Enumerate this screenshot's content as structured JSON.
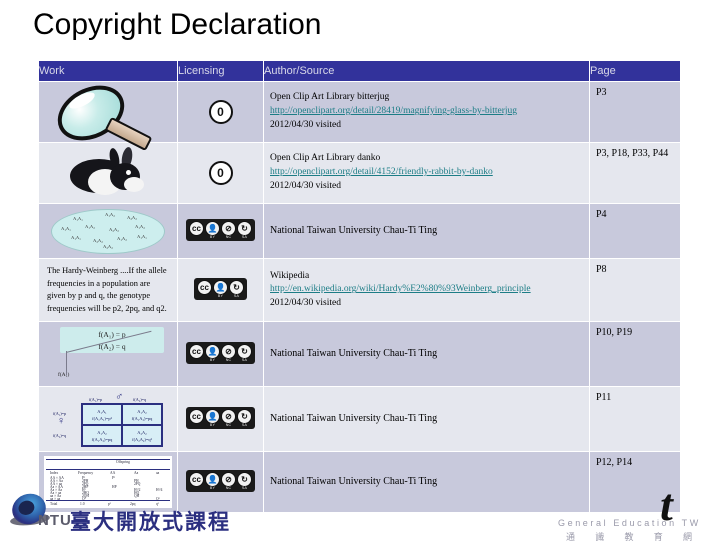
{
  "title": "Copyright Declaration",
  "table": {
    "columns": [
      "Work",
      "Licensing",
      "Author/Source",
      "Page"
    ],
    "rows": [
      {
        "work_kind": "magnifier-thumbnail",
        "license": "cc0",
        "license_label": "0",
        "source_title": "Open Clip Art Library bitterjug",
        "source_url": "http://openclipart.org/detail/28419/magnifying-glass-by-bitterjug",
        "source_date": "2012/04/30 visited",
        "page": "P3"
      },
      {
        "work_kind": "rabbit-thumbnail",
        "license": "cc0",
        "license_label": "0",
        "source_title": "Open Clip Art Library danko",
        "source_url": "http://openclipart.org/detail/4152/friendly-rabbit-by-danko",
        "source_date": "2012/04/30 visited",
        "page": "P3, P18, P33, P44"
      },
      {
        "work_kind": "gene-pool-thumbnail",
        "license": "cc-by-nc-sa",
        "license_marks": [
          "BY",
          "NC",
          "SA"
        ],
        "source_plain": "National Taiwan University Chau-Ti Ting",
        "page": "P4"
      },
      {
        "work_kind": "text-excerpt",
        "work_text": "The Hardy-Weinberg ....If the allele frequencies in a population are given by p and q, the genotype frequencies will be p2, 2pq, and q2.",
        "license": "cc-by-sa",
        "license_marks": [
          "BY",
          "SA"
        ],
        "source_title": "Wikipedia",
        "source_url": "http://en.wikipedia.org/wiki/Hardy%E2%80%93Weinberg_principle",
        "source_date": "2012/04/30 visited",
        "page": "P8"
      },
      {
        "work_kind": "formula-thumbnail",
        "formula_lines": [
          "f(A₁) = p",
          "f(A₂) = q"
        ],
        "formula_label": "f(A₁)",
        "license": "cc-by-nc-sa",
        "license_marks": [
          "BY",
          "NC",
          "SA"
        ],
        "source_plain": "National Taiwan University Chau-Ti Ting",
        "page": "P10, P19"
      },
      {
        "work_kind": "punnett-thumbnail",
        "punnett": {
          "male_head": [
            "p",
            "f(A₁)=p",
            "q",
            "f(A₂)=q"
          ],
          "female_head": [
            "p",
            "f(A₁)=p",
            "q",
            "f(A₂)=q"
          ],
          "cells": [
            [
              "A₁A₁",
              "f(A₁A₁)=p²"
            ],
            [
              "A₁A₂",
              "f(A₁A₂)=pq"
            ],
            [
              "A₁A₂",
              "f(A₁A₂)=pq"
            ],
            [
              "A₂A₂",
              "f(A₂A₂)=q²"
            ]
          ]
        },
        "license": "cc-by-nc-sa",
        "license_marks": [
          "BY",
          "NC",
          "SA"
        ],
        "source_plain": "National Taiwan University Chau-Ti Ting",
        "page": "P11"
      },
      {
        "work_kind": "offspring-table-thumbnail",
        "datatable": {
          "group_header": "Offspring",
          "headers": [
            "Index",
            "Frequency",
            "AA",
            "Aa",
            "aa"
          ],
          "rows": [
            [
              "AA × AA",
              "P²",
              "P²",
              "",
              ""
            ],
            [
              "AA × Aa",
              "2PH",
              "PH",
              "PH",
              ""
            ],
            [
              "AA × aa",
              "2PQ",
              "",
              "2PQ",
              ""
            ],
            [
              "Aa × AA",
              "2HP",
              "HP",
              "HP",
              ""
            ],
            [
              "Aa × Aa",
              "H²",
              "H²/4",
              "H²/2",
              "H²/4"
            ],
            [
              "Aa × aa",
              "2HQ",
              "",
              "HQ",
              "HQ"
            ],
            [
              "aa × AA",
              "2QP",
              "",
              "2QP",
              ""
            ],
            [
              "aa × Aa",
              "2QH",
              "",
              "QH",
              "QH"
            ],
            [
              "aa × aa",
              "Q²",
              "",
              "",
              "Q²"
            ]
          ],
          "total_row": [
            "Total",
            "1.0",
            "p²",
            "2pq",
            "q²"
          ]
        },
        "license": "cc-by-nc-sa",
        "license_marks": [
          "BY",
          "NC",
          "SA"
        ],
        "source_plain": "National Taiwan University Chau-Ti Ting",
        "page": "P12, P14"
      }
    ]
  },
  "gene_pool_alleles": [
    "A₁A₁",
    "A₁A₂",
    "A₂A₂",
    "A₁A₁",
    "A₁A₂",
    "A₂A₂",
    "A₁A₂",
    "A₁A₁",
    "A₂A₂",
    "A₁A₂",
    "A₁A₁",
    "A₂A₂"
  ],
  "footer": {
    "ntu_abbr": "NTU",
    "ntu_cn": "臺大開放式課程",
    "ge_mark": "t",
    "ge_text": "General Education TW",
    "ge_cn": "通 識 教 育 網"
  },
  "colors": {
    "header_bg": "#32329b",
    "row_odd": "#c8c9dc",
    "row_even": "#e5e7ee",
    "link": "#1c7d86"
  }
}
